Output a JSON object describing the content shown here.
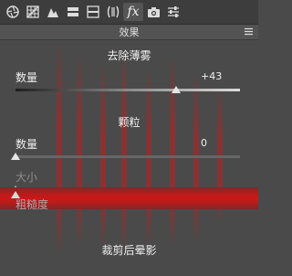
{
  "toolbar": {
    "tools": [
      {
        "icon": "aperture-icon"
      },
      {
        "icon": "grid-icon"
      },
      {
        "icon": "mountain-icon"
      },
      {
        "icon": "split-panels-icon"
      },
      {
        "icon": "sliders-panel-icon"
      },
      {
        "icon": "lens-brackets-icon"
      },
      {
        "icon": "fx-icon",
        "label": "fx",
        "active": true
      },
      {
        "icon": "camera-icon"
      },
      {
        "icon": "presets-icon"
      }
    ]
  },
  "panel": {
    "title": "效果"
  },
  "dehaze": {
    "section_title": "去除薄雾",
    "amount_label": "数量",
    "amount_value": "+43",
    "amount_number": 43,
    "min": -100,
    "max": 100
  },
  "grain": {
    "section_title": "颗粒",
    "amount_label": "数量",
    "amount_value": "0",
    "amount_number": 0,
    "size_label": "大小",
    "roughness_label": "粗糙度"
  },
  "vignette": {
    "section_title": "裁剪后晕影"
  },
  "colors": {
    "panel_bg": "#4a4a4a",
    "toolbar_bg": "#3d3d3d",
    "highlight_red": "#cc1717"
  }
}
